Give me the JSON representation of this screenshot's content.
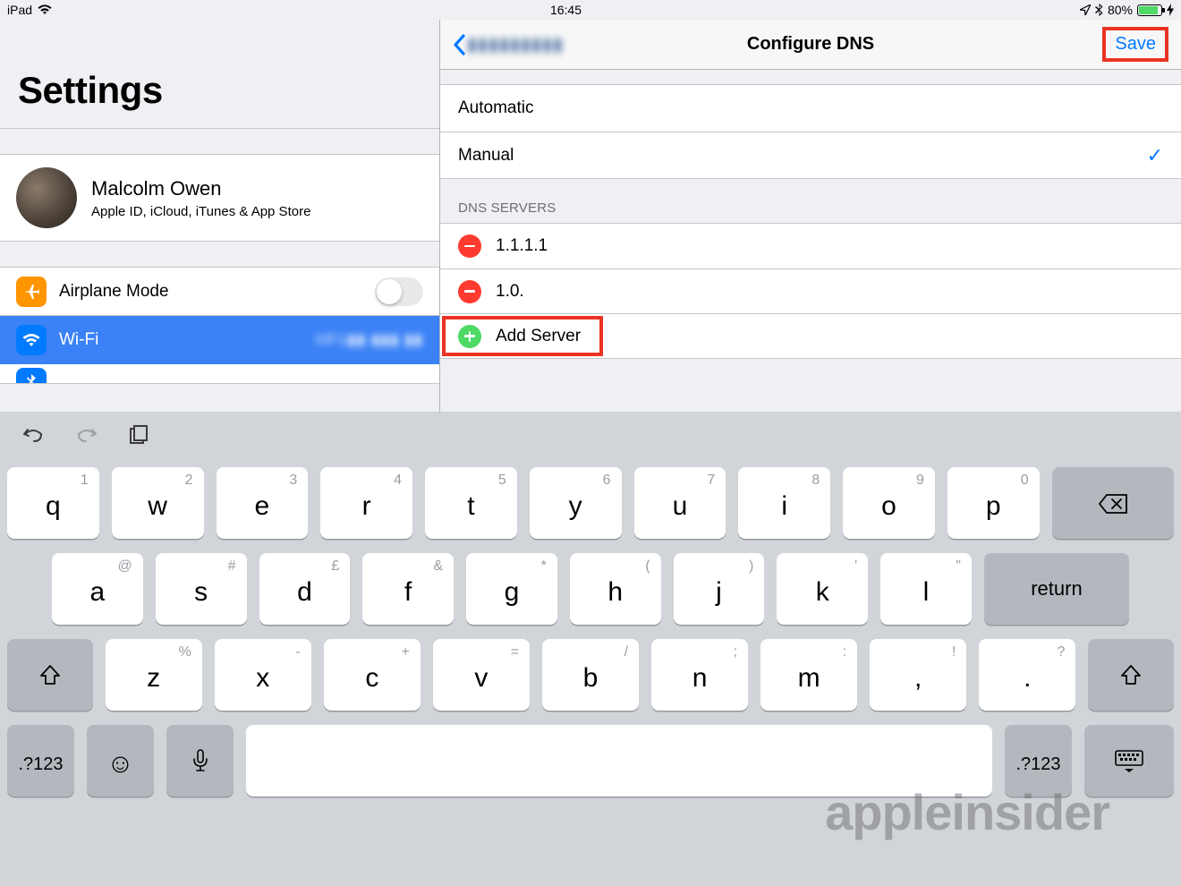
{
  "status": {
    "device": "iPad",
    "time": "16:45",
    "battery_pct": "80%"
  },
  "sidebar": {
    "title": "Settings",
    "profile": {
      "name": "Malcolm Owen",
      "subtitle": "Apple ID, iCloud, iTunes & App Store"
    },
    "items": {
      "airplane": "Airplane Mode",
      "wifi": "Wi-Fi",
      "wifi_detail": "HF1▮▮-▮▮▮ ▮▮",
      "bluetooth": "Bluetooth"
    }
  },
  "detail": {
    "back_label": "▮▮▮▮▮▮▮▮▮",
    "title": "Configure DNS",
    "save": "Save",
    "mode_auto": "Automatic",
    "mode_manual": "Manual",
    "section_header": "DNS SERVERS",
    "servers": {
      "s1": "1.1.1.1",
      "s2": "1.0."
    },
    "add_server": "Add Server"
  },
  "keyboard": {
    "row1": [
      {
        "sub": "1",
        "main": "q"
      },
      {
        "sub": "2",
        "main": "w"
      },
      {
        "sub": "3",
        "main": "e"
      },
      {
        "sub": "4",
        "main": "r"
      },
      {
        "sub": "5",
        "main": "t"
      },
      {
        "sub": "6",
        "main": "y"
      },
      {
        "sub": "7",
        "main": "u"
      },
      {
        "sub": "8",
        "main": "i"
      },
      {
        "sub": "9",
        "main": "o"
      },
      {
        "sub": "0",
        "main": "p"
      }
    ],
    "row2": [
      {
        "sub": "@",
        "main": "a"
      },
      {
        "sub": "#",
        "main": "s"
      },
      {
        "sub": "£",
        "main": "d"
      },
      {
        "sub": "&",
        "main": "f"
      },
      {
        "sub": "*",
        "main": "g"
      },
      {
        "sub": "(",
        "main": "h"
      },
      {
        "sub": ")",
        "main": "j"
      },
      {
        "sub": "'",
        "main": "k"
      },
      {
        "sub": "\"",
        "main": "l"
      }
    ],
    "row3": [
      {
        "sub": "%",
        "main": "z"
      },
      {
        "sub": "-",
        "main": "x"
      },
      {
        "sub": "+",
        "main": "c"
      },
      {
        "sub": "=",
        "main": "v"
      },
      {
        "sub": "/",
        "main": "b"
      },
      {
        "sub": ";",
        "main": "n"
      },
      {
        "sub": ":",
        "main": "m"
      },
      {
        "sub": "!",
        "main": ","
      },
      {
        "sub": "?",
        "main": "."
      }
    ],
    "return_label": "return",
    "sym_label": ".?123"
  },
  "watermark": "appleinsider"
}
